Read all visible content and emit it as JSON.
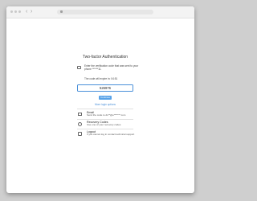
{
  "browser": {
    "url": "",
    "back_glyph": "‹",
    "forward_glyph": "›"
  },
  "auth": {
    "title": "Two-factor Authentication",
    "message": "Enter the verification code that was sent to your phone ******11.",
    "expiry": "The code will expire in: 04:51",
    "code_value": "526976",
    "continue_label": "Continue",
    "more_options_label": "More login options"
  },
  "options": [
    {
      "title": "Email",
      "description": "Send the code to ds**@e*******.com",
      "icon": "envelope-icon"
    },
    {
      "title": "Recovery Codes",
      "description": "Use one of your recovery codes",
      "icon": "key-icon"
    },
    {
      "title": "Logout",
      "description": "If you cannot log in contact technical support",
      "icon": "logout-icon"
    }
  ],
  "colors": {
    "accent": "#4a90d9",
    "button": "#5aa3e8"
  }
}
